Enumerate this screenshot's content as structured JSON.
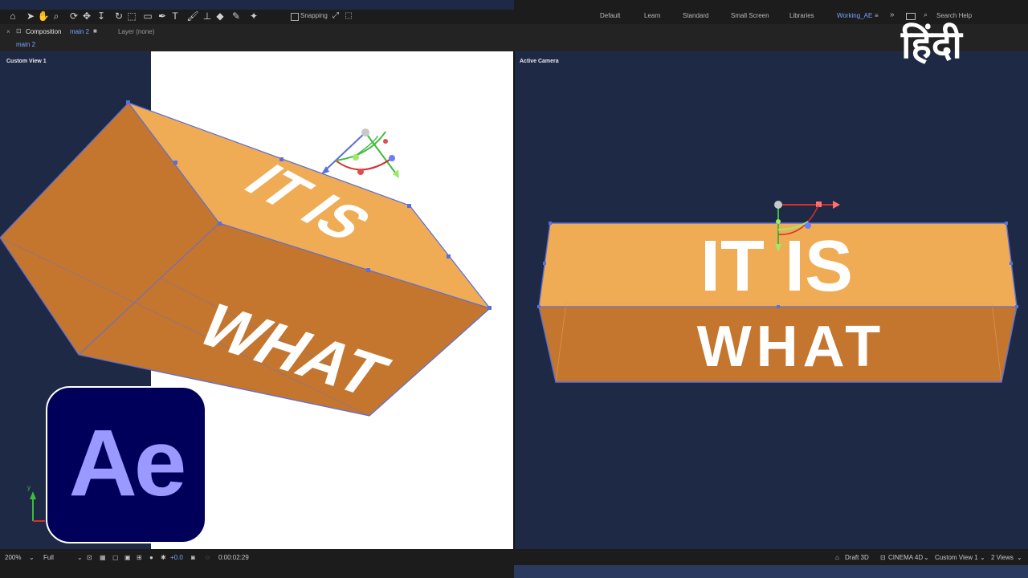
{
  "toolbar": {
    "snapping_label": "Snapping",
    "workspaces": [
      "Default",
      "Learn",
      "Standard",
      "Small Screen",
      "Libraries"
    ],
    "active_workspace": "Working_AE",
    "search_placeholder": "Search Help"
  },
  "tabs": {
    "composition_prefix": "Composition",
    "composition_name": "main 2",
    "layer_label": "Layer (none)",
    "breadcrumb": "main 2"
  },
  "views": {
    "left_label": "Custom View 1",
    "right_label": "Active Camera"
  },
  "artwork": {
    "top_text": "IT IS",
    "front_text": "WHAT",
    "box_color": "#f0ab55",
    "front_color": "#c4762f",
    "outline_color": "#5a6fd8"
  },
  "status": {
    "zoom": "200%",
    "resolution": "Full",
    "exposure": "+0.0",
    "timecode": "0:00:02:29",
    "draft": "Draft 3D",
    "renderer": "CINEMA 4D",
    "view_menu": "Custom View 1",
    "view_layout": "2 Views"
  },
  "overlay": {
    "ae_logo_text": "Ae",
    "hindi_title": "हिंदी",
    "accent": "#9999ff"
  }
}
